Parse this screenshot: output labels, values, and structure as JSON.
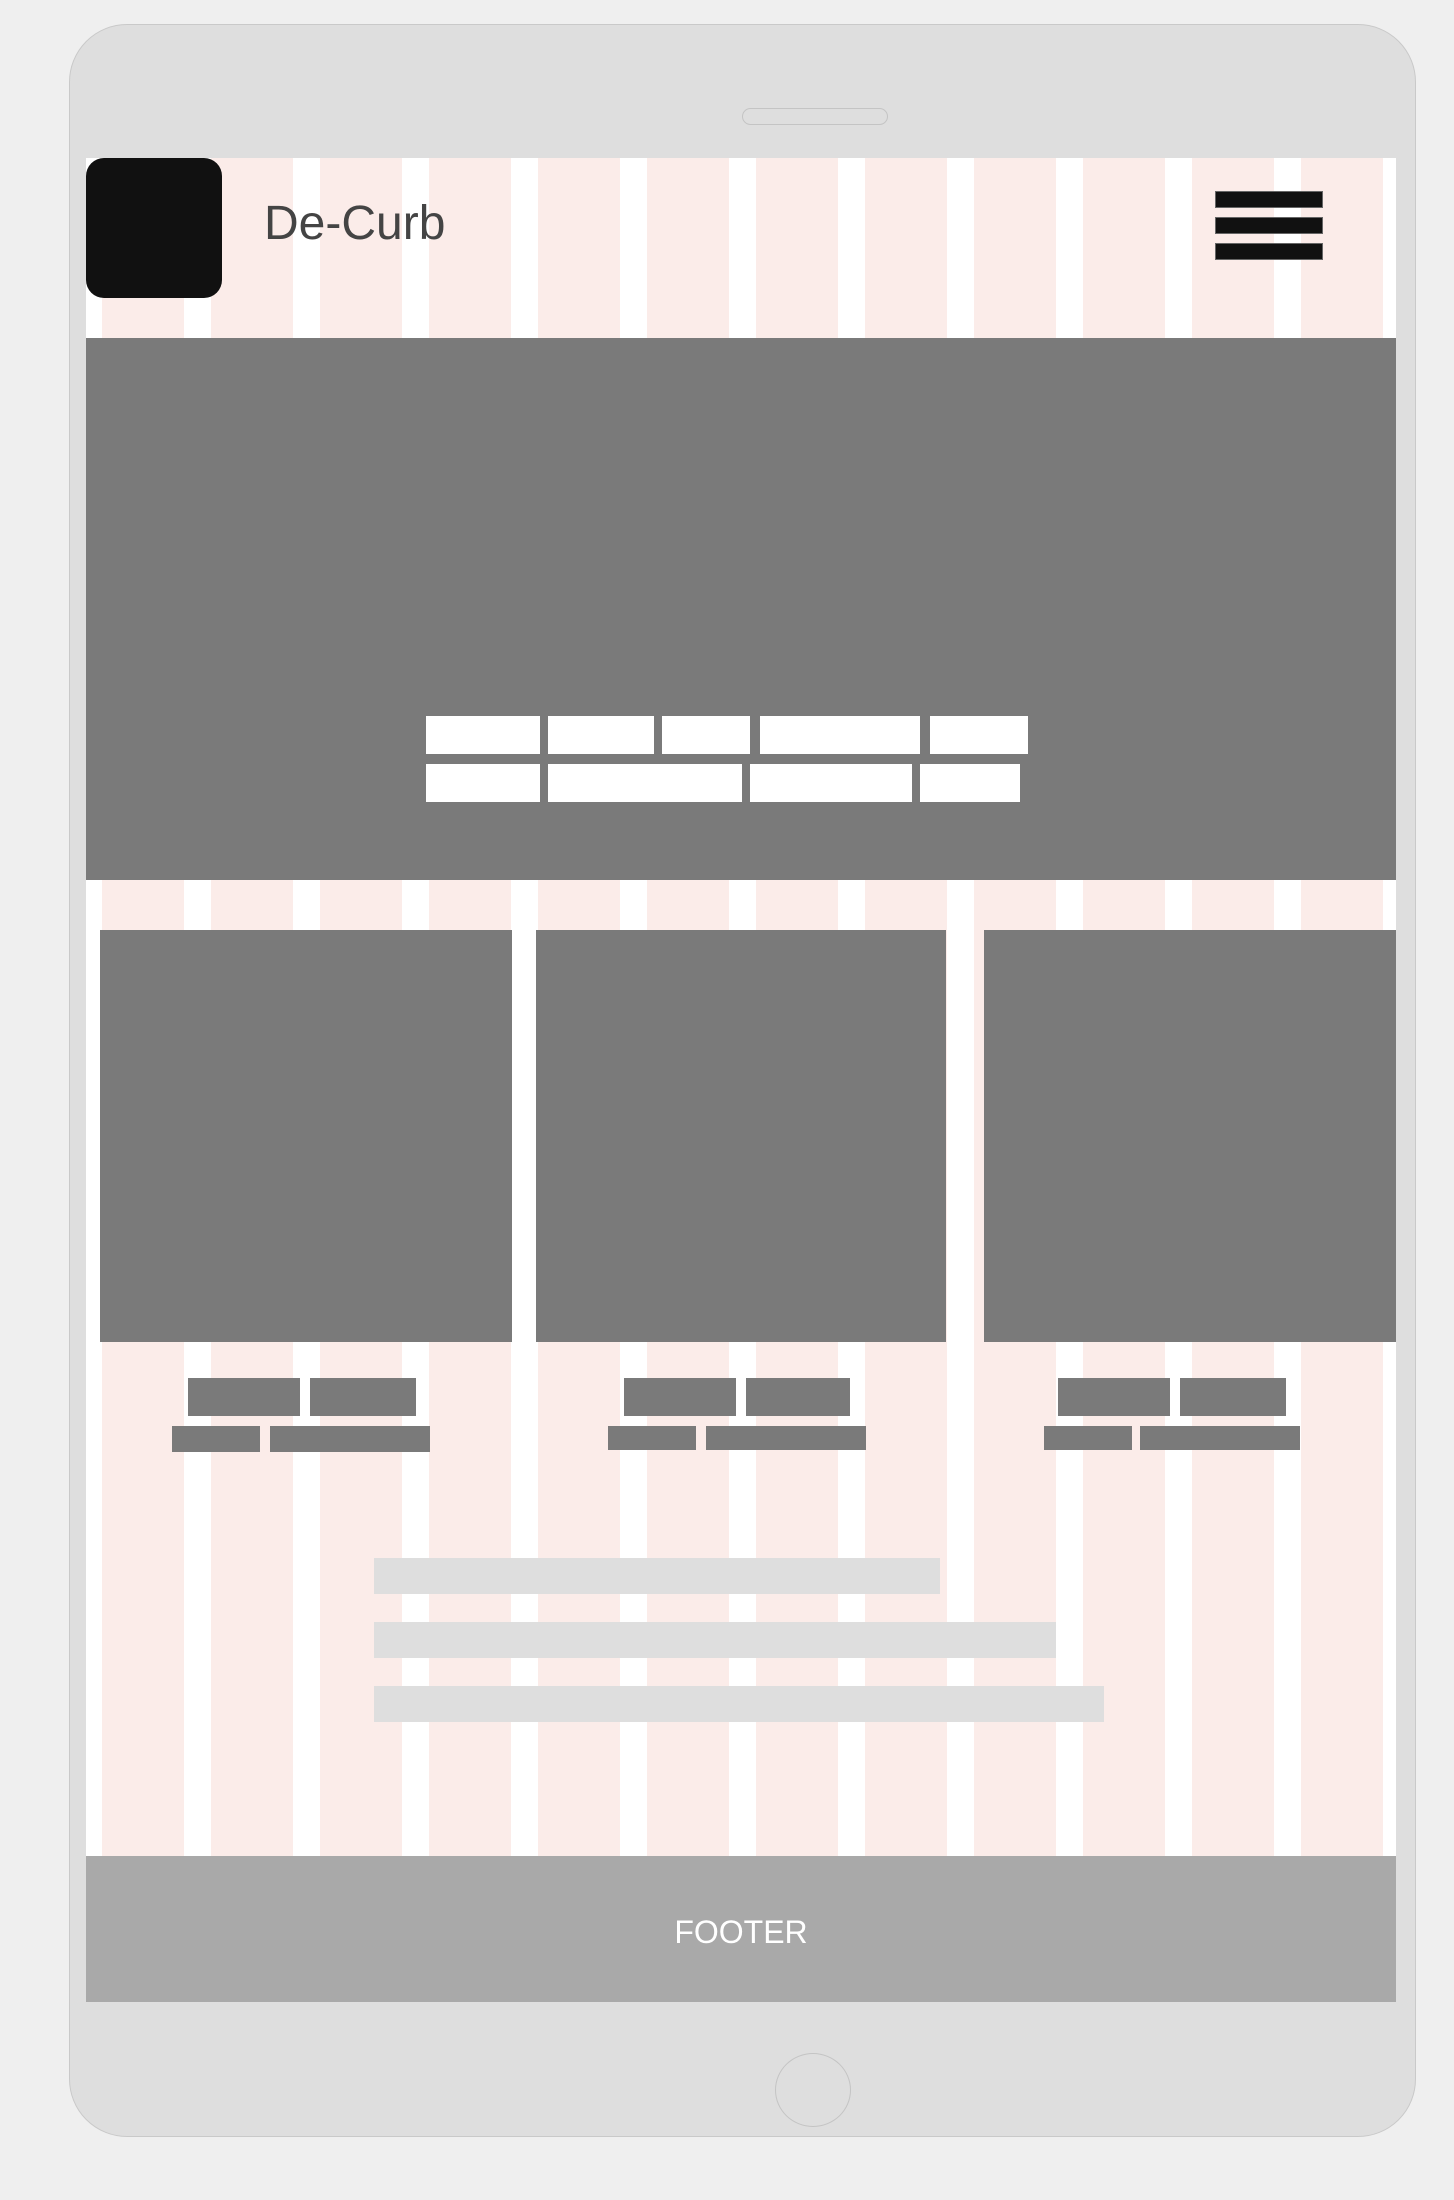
{
  "header": {
    "brand_name": "De-Curb"
  },
  "footer": {
    "label": "FOOTER"
  },
  "colors": {
    "page_background": "#efefef",
    "device_frame": "#dedede",
    "grid_column": "#fbece9",
    "placeholder_dark": "#7a7a7a",
    "placeholder_light": "#dedede",
    "footer_background": "#a9a9a9",
    "logo": "#111111"
  },
  "icons": {
    "menu": "hamburger-icon"
  }
}
